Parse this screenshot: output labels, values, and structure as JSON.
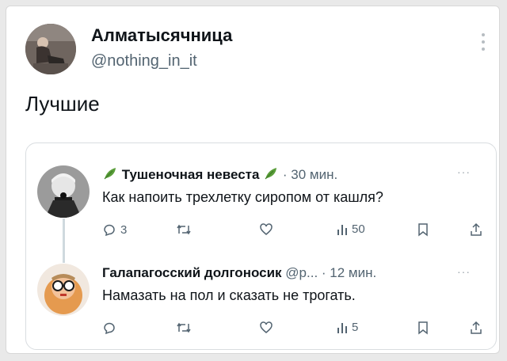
{
  "post": {
    "author_name": "Алматысячница",
    "author_handle": "@nothing_in_it",
    "text": "Лучшие"
  },
  "thread": {
    "tweet1": {
      "name": "Тушеночная невеста",
      "meta": "· 30 мин.",
      "text": "Как напоить трехлетку сиропом от кашля?",
      "replies": "3",
      "retweets": "",
      "likes": "",
      "views": "50"
    },
    "tweet2": {
      "name": "Галапагосский долгоносик",
      "meta": "@р... · 12 мин.",
      "text": "Намазать на пол и сказать не трогать.",
      "replies": "",
      "retweets": "",
      "likes": "",
      "views": "5"
    }
  },
  "icons": {
    "more": "more-vertical-icon",
    "reply": "reply-icon",
    "retweet": "retweet-icon",
    "like": "heart-icon",
    "views": "views-icon",
    "bookmark": "bookmark-icon",
    "share": "share-icon",
    "leaf": "leaf-emoji-icon"
  },
  "colors": {
    "text": "#0f1419",
    "muted": "#536471",
    "leaf": "#5a9e3a"
  }
}
